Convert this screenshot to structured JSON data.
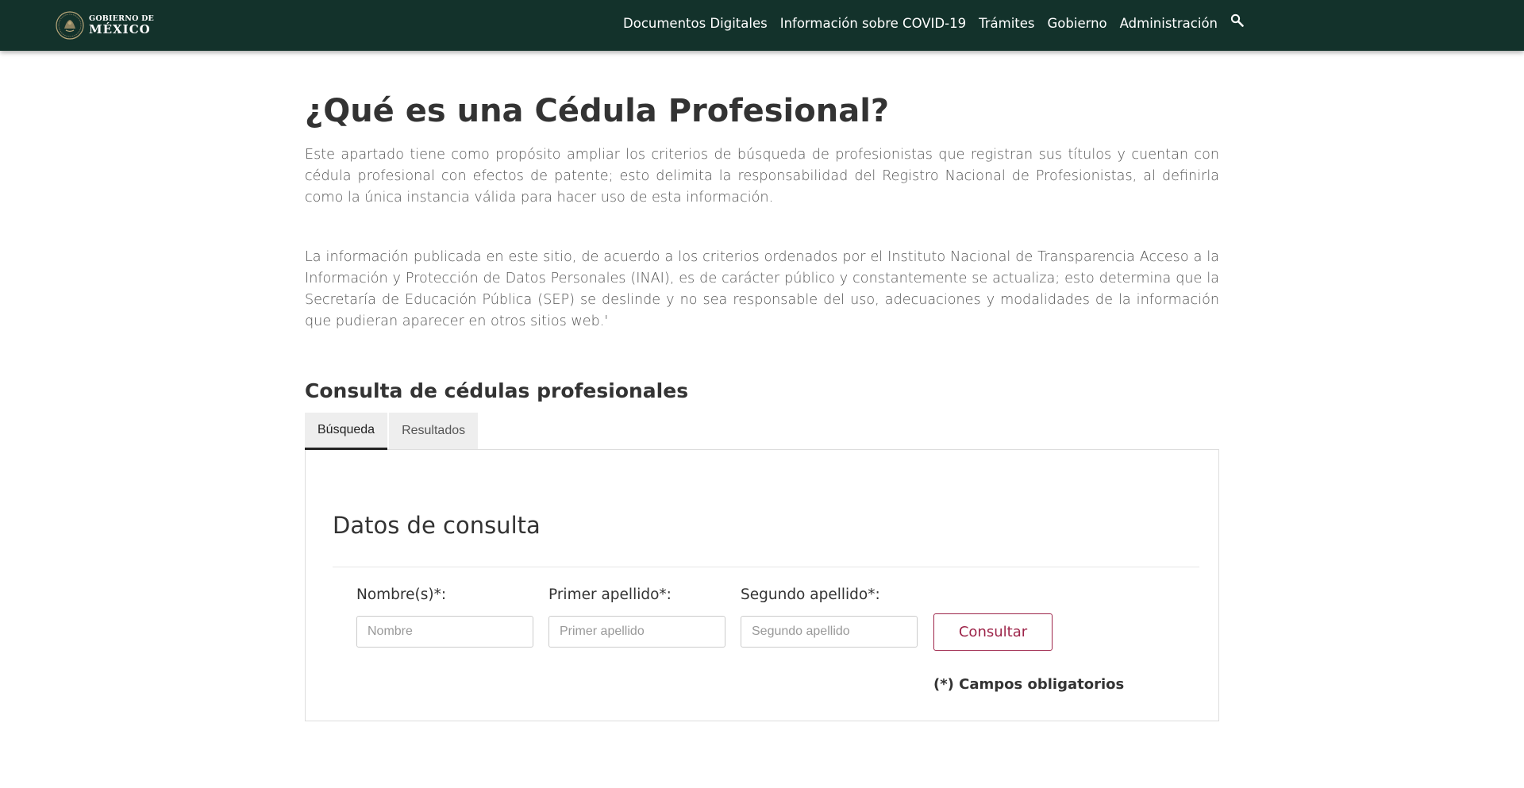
{
  "header": {
    "logo_line1": "GOBIERNO DE",
    "logo_line2": "MÉXICO",
    "nav_items": [
      "Documentos Digitales",
      "Información sobre COVID-19",
      "Trámites",
      "Gobierno",
      "Administración"
    ],
    "search_icon": "search-icon",
    "background_color": "#13322b"
  },
  "main": {
    "title": "¿Qué es una Cédula Profesional?",
    "paragraph_1": "Este apartado tiene como propósito ampliar los criterios de búsqueda de profesionistas que registran sus títulos y cuentan con cédula profesional con efectos de patente; esto delimita la responsabilidad del Registro Nacional de Profesionistas, al definirla como la única instancia válida para hacer uso de esta información.",
    "paragraph_2": "La información publicada en este sitio, de acuerdo a los criterios ordenados por el Instituto Nacional de Transparencia Acceso a la Información y Protección de Datos Personales (INAI), es de carácter público y constantemente se actualiza; esto determina que la Secretaría de Educación Pública (SEP) se deslinde y no sea responsable del uso, adecuaciones y modalidades de la información que pudieran aparecer en otros sitios web.'",
    "section_title": "Consulta de cédulas profesionales",
    "tabs": [
      {
        "label": "Búsqueda",
        "active": true
      },
      {
        "label": "Resultados",
        "active": false
      }
    ]
  },
  "form": {
    "title": "Datos de consulta",
    "nombre_label": "Nombre(s)*:",
    "nombre_placeholder": "Nombre",
    "nombre_value": "",
    "primer_apellido_label": "Primer apellido*:",
    "primer_apellido_placeholder": "Primer apellido",
    "primer_apellido_value": "",
    "segundo_apellido_label": "Segundo apellido*:",
    "segundo_apellido_placeholder": "Segundo apellido",
    "segundo_apellido_value": "",
    "submit_label": "Consultar",
    "required_note": "(*) Campos obligatorios",
    "accent_color": "#9d2449"
  }
}
